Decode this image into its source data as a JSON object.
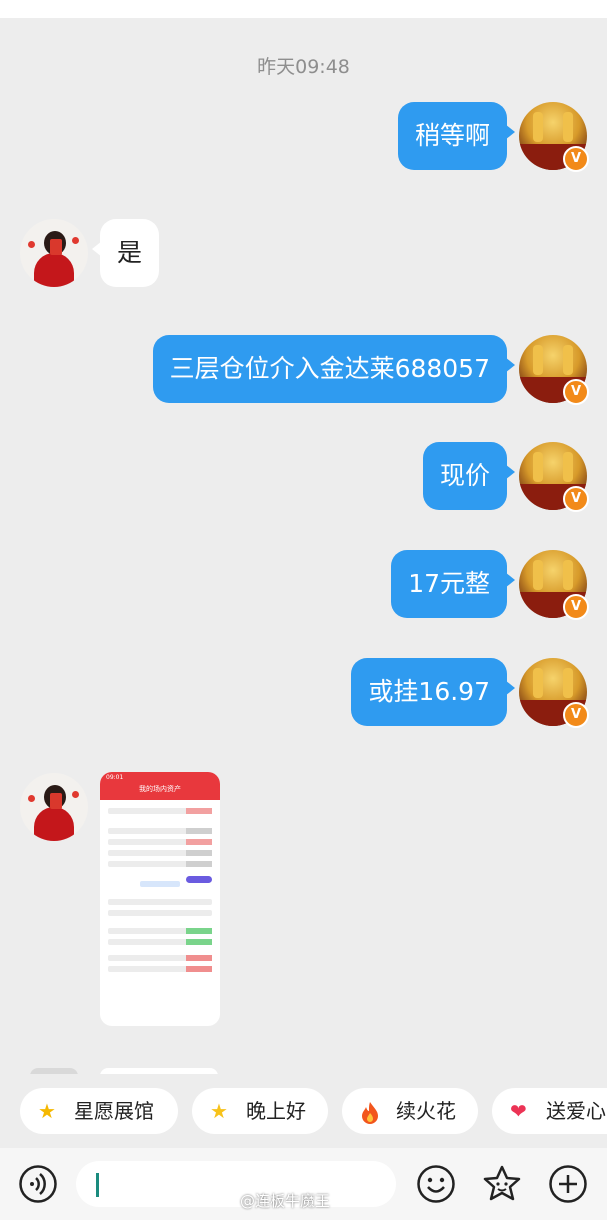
{
  "timestamp": "昨天09:48",
  "messages": [
    {
      "text": "稍等啊",
      "dir": "out"
    },
    {
      "text": "是",
      "dir": "in"
    },
    {
      "text": "三层仓位介入金达莱688057",
      "dir": "out"
    },
    {
      "text": "现价",
      "dir": "out"
    },
    {
      "text": "17元整",
      "dir": "out"
    },
    {
      "text": "或挂16.97",
      "dir": "out"
    }
  ],
  "verified_badge": "V",
  "image_message": {
    "header_title": "我的场内资产",
    "status_time": "09:01"
  },
  "quick_replies": [
    {
      "icon": "star-icon",
      "label": "星愿展馆"
    },
    {
      "icon": "sparkle-star-icon",
      "label": "晚上好"
    },
    {
      "icon": "fire-icon",
      "label": "续火花"
    },
    {
      "icon": "heart-icon",
      "label": "送爱心"
    }
  ],
  "input": {
    "placeholder": ""
  },
  "watermark": "@连板牛魔王",
  "colors": {
    "bubble_out": "#2f9bf0",
    "badge": "#f28a19",
    "accent_header": "#e8383d"
  }
}
